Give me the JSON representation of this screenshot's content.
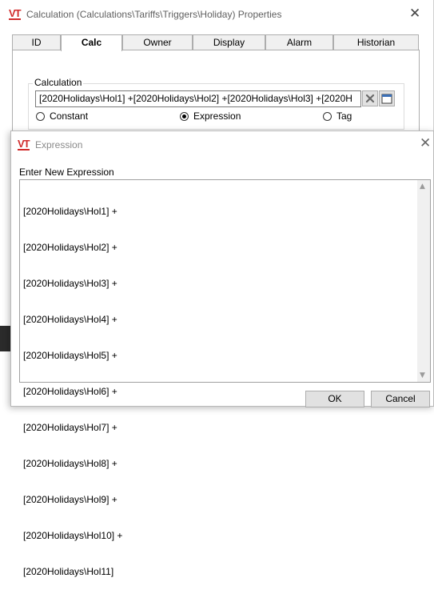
{
  "properties_window": {
    "logo": "VT",
    "title": "Calculation (Calculations\\Tariffs\\Triggers\\Holiday) Properties",
    "close_symbol": "✕",
    "tabs": [
      {
        "label": "ID",
        "active": false
      },
      {
        "label": "Calc",
        "active": true
      },
      {
        "label": "Owner",
        "active": false
      },
      {
        "label": "Display",
        "active": false
      },
      {
        "label": "Alarm",
        "active": false
      },
      {
        "label": "Historian",
        "active": false
      }
    ],
    "calculation": {
      "group_label": "Calculation",
      "value": "[2020Holidays\\Hol1] +[2020Holidays\\Hol2] +[2020Holidays\\Hol3] +[2020H",
      "clear_icon": "clear-x-icon",
      "editor_icon": "window-editor-icon",
      "options": [
        {
          "label": "Constant",
          "selected": false
        },
        {
          "label": "Expression",
          "selected": true
        },
        {
          "label": "Tag",
          "selected": false
        }
      ]
    }
  },
  "expression_dialog": {
    "logo": "VT",
    "title": "Expression",
    "close_symbol": "✕",
    "prompt": "Enter New Expression",
    "lines": [
      "[2020Holidays\\Hol1] +",
      "[2020Holidays\\Hol2] +",
      "[2020Holidays\\Hol3] +",
      "[2020Holidays\\Hol4] +",
      "[2020Holidays\\Hol5] +",
      "[2020Holidays\\Hol6] +",
      "[2020Holidays\\Hol7] +",
      "[2020Holidays\\Hol8] +",
      "[2020Holidays\\Hol9] +",
      "[2020Holidays\\Hol10] +",
      "[2020Holidays\\Hol11]"
    ],
    "ok_label": "OK",
    "cancel_label": "Cancel"
  },
  "colors": {
    "logo_red": "#d12b2b",
    "button_face": "#e1e1e1",
    "tab_inactive": "#f0f0f0"
  }
}
